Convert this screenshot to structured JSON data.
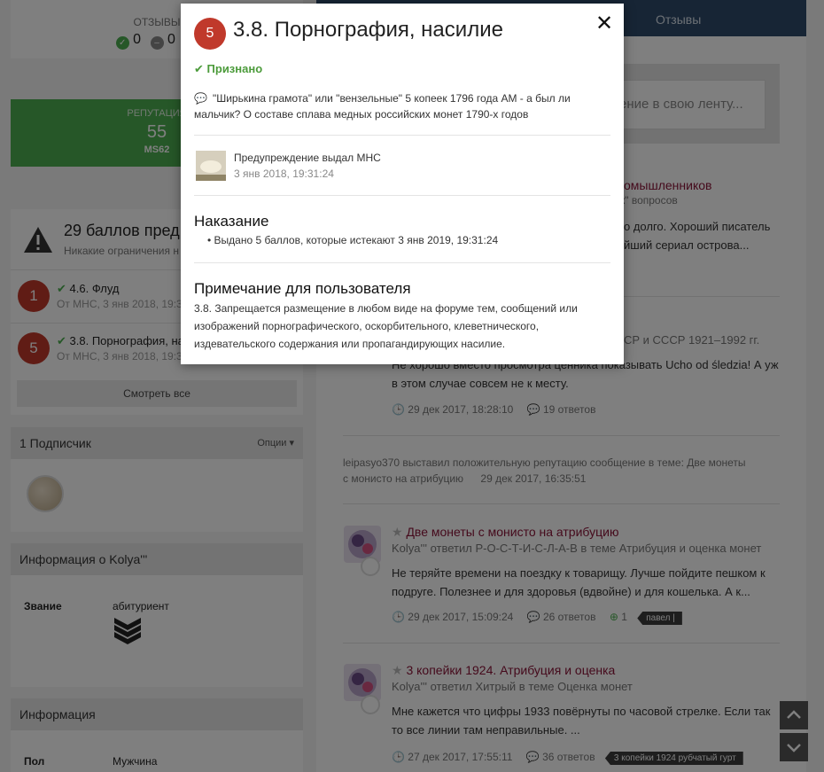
{
  "profile": {
    "reviews": {
      "label": "ОТЗЫВЫ",
      "positive": "0",
      "neutral": "0"
    },
    "reputation": {
      "label": "РЕПУТАЦИЯ",
      "value": "55",
      "grade": "MS62"
    },
    "warnings": {
      "title": "29 баллов пред",
      "subtitle": "Никакие ограничения н",
      "items": [
        {
          "points": "1",
          "title": "4.6. Флуд",
          "meta": "От МНС, 3 янв 2018, 19:3"
        },
        {
          "points": "5",
          "title": "3.8. Порнография, на",
          "meta": "От МНС, 3 янв 2018, 19:3"
        }
      ],
      "see_all": "Смотреть все"
    },
    "followers": {
      "title": "1 Подписчик",
      "options": "Опции"
    },
    "about": {
      "title": "Информация о Kolya'''",
      "rank_label": "Звание",
      "rank_value": "абитуриент"
    },
    "info": {
      "title": "Информация",
      "gender_label": "Пол",
      "gender_value": "Мужчина"
    }
  },
  "feed": {
    "tab_reviews": "Отзывы",
    "placeholder": "ение в свою ленту...",
    "items": [
      {
        "title_fragment": "омышленников",
        "meta_fragment": "к\" вопросов",
        "text_line1": "о долго. Хороший писатель",
        "text_line2": "йший сериал острова..."
      },
      {
        "meta_fragment": "СР и СССР 1921–1992 гг.",
        "text_line1": "Не хорошо вместо просмотра ценника показывать Ucho od śledzia! А уж",
        "text_line2": "в этом случае совсем не к месту.",
        "date": "29 дек 2017, 18:28:10",
        "replies": "19 ответов"
      },
      {
        "activity": "leipasyo370 выставил положительную репутацию сообщение в теме: Две монеты",
        "activity2": "с монисто на атрибуцию",
        "activity_date": "29 дек 2017, 16:35:51"
      },
      {
        "title": "Две монеты с монисто на атрибуцию",
        "meta_user": "Kolya'''",
        "meta_mid": " ответил ",
        "meta_user2": "Р-О-С-Т-И-С-Л-А-В",
        "meta_in": " в теме ",
        "meta_topic": "Атрибуция и оценка монет",
        "text_line1": "Не теряйте времени на поездку к товарищу. Лучше пойдите пешком к",
        "text_line2": "подруге. Полезнее и для здоровья (вдвойне) и для кошелька. А к...",
        "date": "29 дек 2017, 15:09:24",
        "replies": "26 ответов",
        "likes": "1",
        "tag": "павел |"
      },
      {
        "title": "3 копейки 1924. Атрибуция и оценка",
        "meta_user": "Kolya'''",
        "meta_mid": " ответил ",
        "meta_user2": "Хитрый",
        "meta_in": " в теме ",
        "meta_topic": "Оценка монет",
        "text_line1": "Мне кажется что цифры 1933 повёрнуты по часовой стрелке. Если так",
        "text_line2": "то все линии там неправильные. ...",
        "date": "27 дек 2017, 17:55:11",
        "replies": "36 ответов",
        "tag": "3 копейки 1924 рубчатый гурт"
      }
    ]
  },
  "modal": {
    "points": "5",
    "title": "3.8. Порнография, насилие",
    "status": "Признано",
    "topic": "\"Ширькина грамота\" или \"вензельные\" 5 копеек 1796 года AM - а был ли мальчик? О составе сплава медных российских монет 1790-х годов",
    "issuer": "Предупреждение выдал МНС",
    "date": "3 янв 2018, 19:31:24",
    "penalty_heading": "Наказание",
    "penalty_item": "Выдано 5 баллов, которые истекают 3 янв 2019, 19:31:24",
    "note_heading": "Примечание для пользователя",
    "note_text": "3.8. Запрещается размещение в любом виде на форуме тем, сообщений или изображений порнографического, оскорбительного, клеветнического, издевательского содержания или пропагандирующих насилие."
  },
  "colors": {
    "danger": "#c0392b",
    "success": "#4c9b3b",
    "reputation": "#4caf50",
    "nav": "#2f4a6b",
    "link": "#8a1538"
  }
}
